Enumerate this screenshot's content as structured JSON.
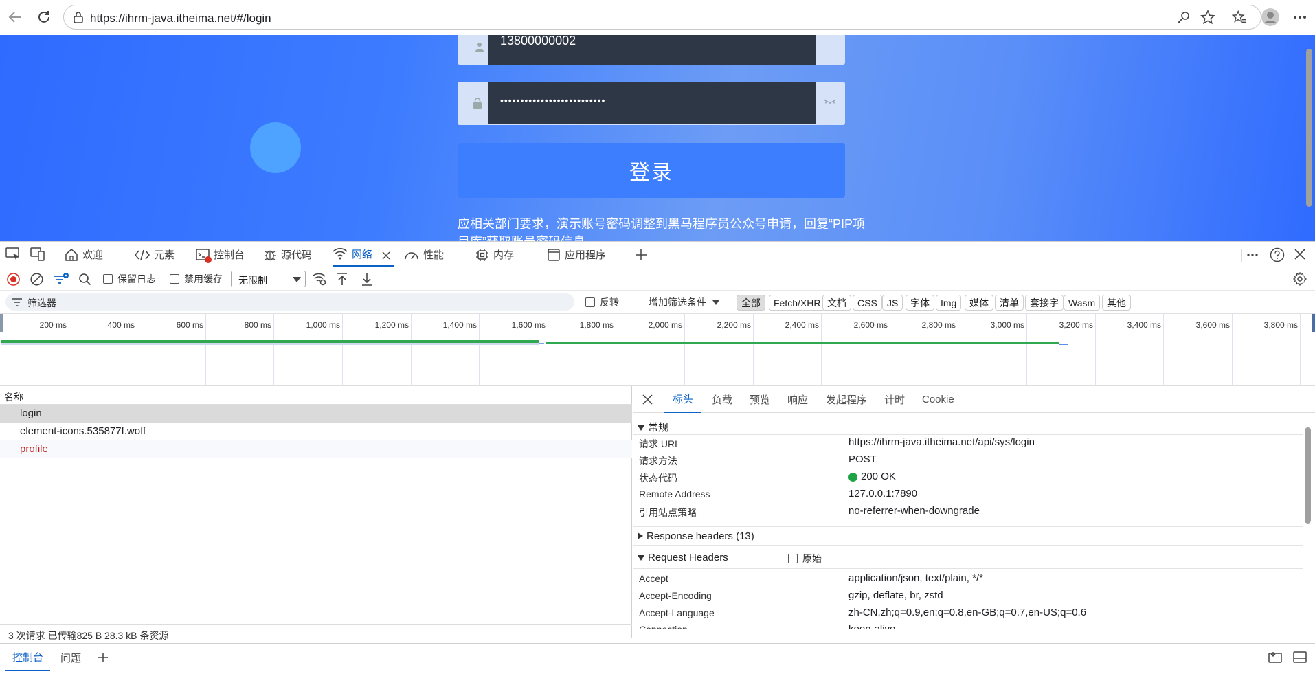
{
  "browser": {
    "url": "https://ihrm-java.itheima.net/#/login",
    "icons": [
      "back-icon",
      "reload-icon",
      "lock-icon",
      "key-icon",
      "star-icon",
      "favorites-icon",
      "profile-icon",
      "more-icon"
    ]
  },
  "page": {
    "username": "13800000002",
    "password_mask": "••••••••••••••••••••••••••",
    "login_label": "登录",
    "notice": "应相关部门要求，演示账号密码调整到黑马程序员公众号申请，回复“PIP项目库”获取账号密码信息"
  },
  "devtools": {
    "tabs": [
      {
        "label": "欢迎",
        "icon": "home-icon"
      },
      {
        "label": "元素",
        "icon": "code-icon"
      },
      {
        "label": "控制台",
        "icon": "console-icon"
      },
      {
        "label": "源代码",
        "icon": "bug-icon"
      },
      {
        "label": "网络",
        "icon": "wifi-icon"
      },
      {
        "label": "性能",
        "icon": "gauge-icon"
      },
      {
        "label": "内存",
        "icon": "memory-icon"
      },
      {
        "label": "应用程序",
        "icon": "app-icon"
      }
    ],
    "toolbar": {
      "preserve_log": "保留日志",
      "disable_cache": "禁用缓存",
      "throttling": "无限制"
    },
    "filter": {
      "placeholder": "筛选器",
      "invert": "反转",
      "more_filters": "增加筛选条件",
      "types": [
        "全部",
        "Fetch/XHR",
        "文档",
        "CSS",
        "JS",
        "字体",
        "Img",
        "媒体",
        "清单",
        "套接字",
        "Wasm",
        "其他"
      ],
      "active_type": "全部"
    },
    "timeline": {
      "ticks": [
        "200 ms",
        "400 ms",
        "600 ms",
        "800 ms",
        "1,000 ms",
        "1,200 ms",
        "1,400 ms",
        "1,600 ms",
        "1,800 ms",
        "2,000 ms",
        "2,200 ms",
        "2,400 ms",
        "2,600 ms",
        "2,800 ms",
        "3,000 ms",
        "3,200 ms",
        "3,400 ms",
        "3,600 ms",
        "3,800 ms"
      ]
    },
    "requests": {
      "header": "名称",
      "rows": [
        {
          "name": "login",
          "selected": true,
          "error": false
        },
        {
          "name": "element-icons.535877f.woff",
          "selected": false,
          "error": false
        },
        {
          "name": "profile",
          "selected": false,
          "error": true
        }
      ],
      "summary": "3 次请求   已传输825 B   28.3 kB 条资源"
    },
    "details": {
      "tabs": [
        "标头",
        "负载",
        "预览",
        "响应",
        "发起程序",
        "计时",
        "Cookie"
      ],
      "active_tab": "标头",
      "general_title": "常规",
      "general": [
        {
          "key": "请求 URL",
          "value": "https://ihrm-java.itheima.net/api/sys/login"
        },
        {
          "key": "请求方法",
          "value": "POST"
        },
        {
          "key": "状态代码",
          "value": "200 OK"
        },
        {
          "key": "Remote Address",
          "value": "127.0.0.1:7890"
        },
        {
          "key": "引用站点策略",
          "value": "no-referrer-when-downgrade"
        }
      ],
      "response_headers_title": "Response headers (13)",
      "request_headers_title": "Request Headers",
      "raw_label": "原始",
      "request_headers": [
        {
          "key": "Accept",
          "value": "application/json, text/plain, */*"
        },
        {
          "key": "Accept-Encoding",
          "value": "gzip, deflate, br, zstd"
        },
        {
          "key": "Accept-Language",
          "value": "zh-CN,zh;q=0.9,en;q=0.8,en-GB;q=0.7,en-US;q=0.6"
        },
        {
          "key": "Connection",
          "value": "keep-alive"
        }
      ],
      "status_color": "#1ea446"
    },
    "drawer": {
      "tabs": [
        "控制台",
        "问题"
      ],
      "active": "控制台"
    }
  }
}
